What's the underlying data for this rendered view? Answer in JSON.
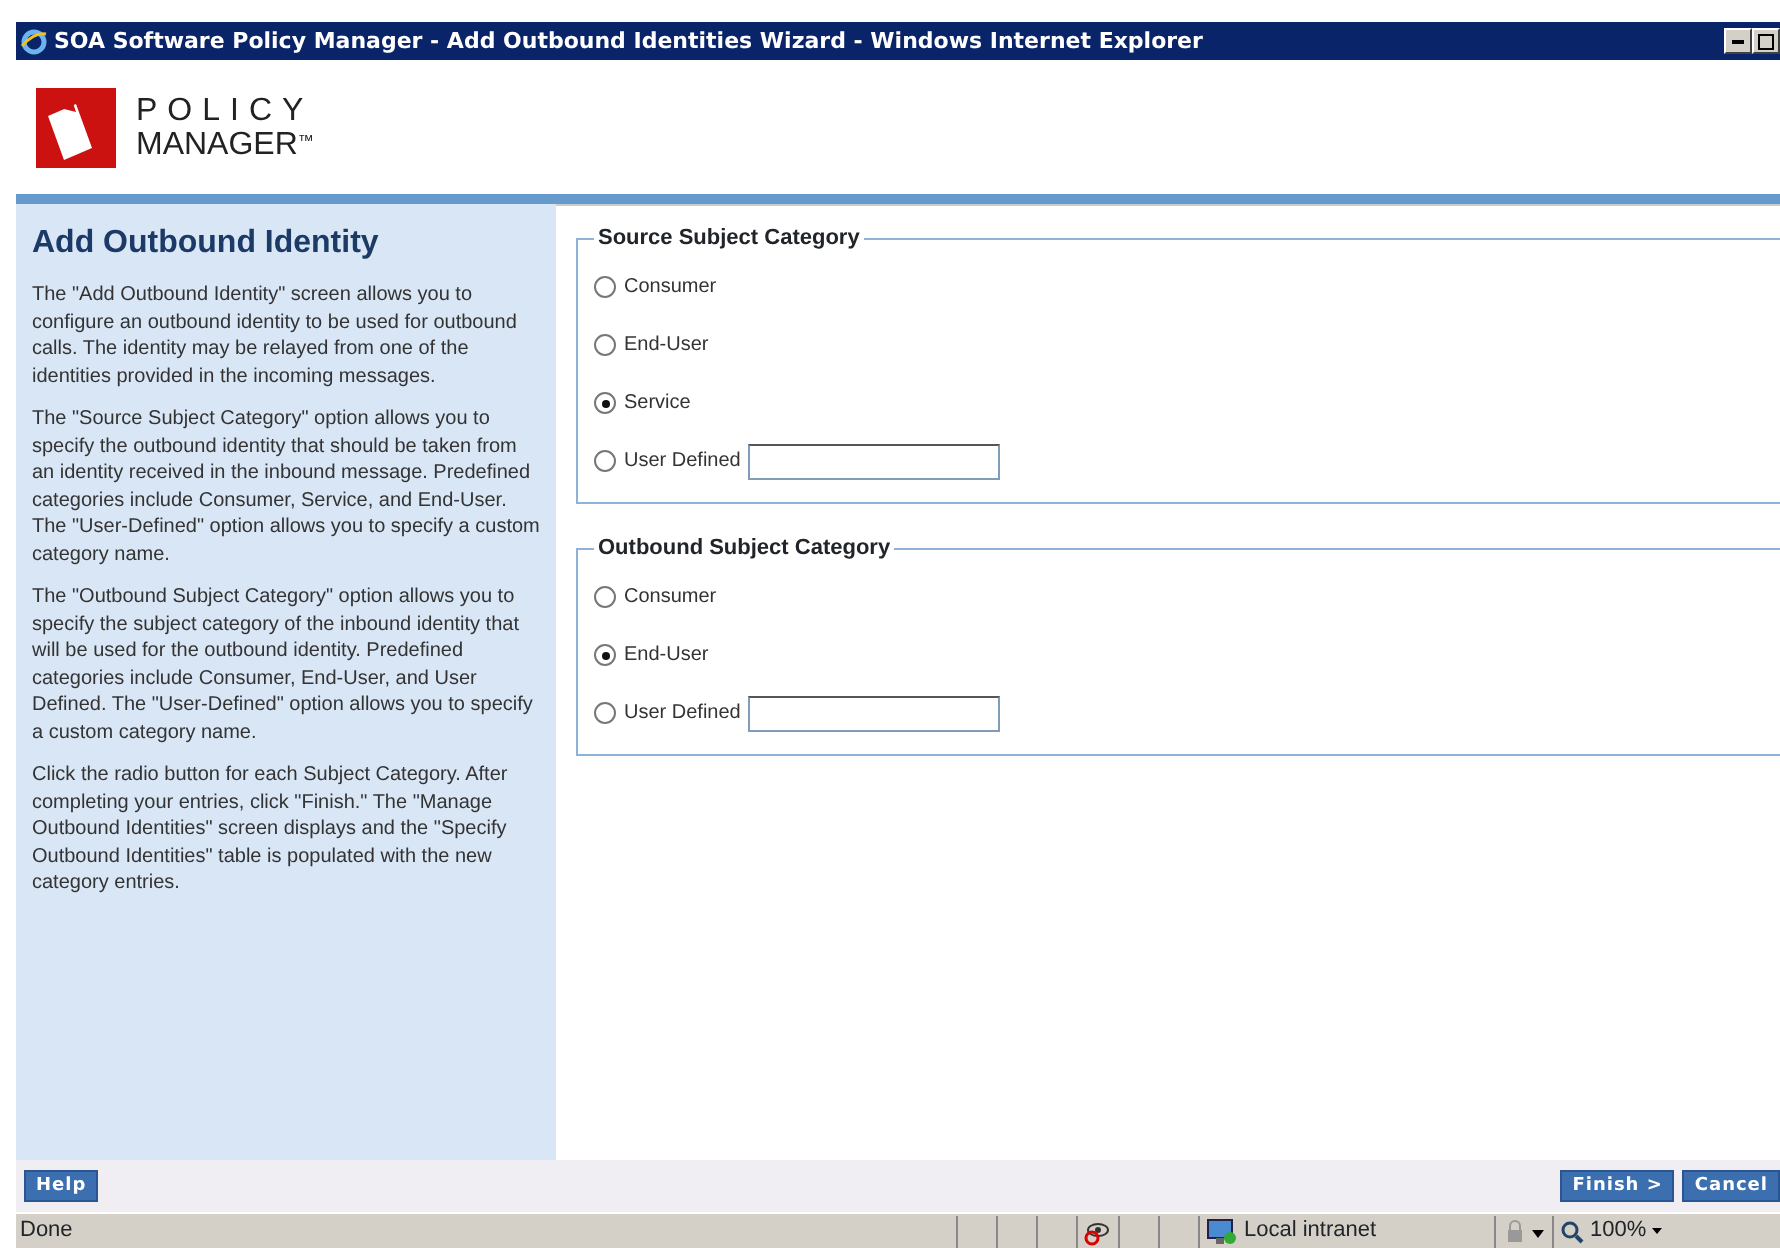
{
  "window": {
    "title": "SOA Software Policy Manager - Add Outbound Identities Wizard - Windows Internet Explorer"
  },
  "logo": {
    "line_1": "POLICY",
    "line_2": "MANAGER",
    "mark": "™"
  },
  "help_panel": {
    "title": "Add Outbound Identity",
    "paragraphs": [
      "The \"Add Outbound Identity\" screen allows you to configure an outbound identity to be used for outbound calls. The identity may be relayed from one of the identities provided in the incoming messages.",
      "The \"Source Subject Category\" option allows you to specify the outbound identity that should be taken from an identity received in the inbound message. Predefined categories include Consumer, Service, and End-User. The \"User-Defined\" option allows you to specify a custom category name.",
      "The \"Outbound Subject Category\" option allows you to specify the subject category of the inbound identity that will be used for the outbound identity. Predefined categories include Consumer, End-User, and User Defined. The \"User-Defined\" option allows you to specify a custom category name.",
      "Click the radio button for each Subject Category. After completing your entries, click \"Finish.\" The \"Manage Outbound Identities\" screen displays and the \"Specify Outbound Identities\" table is populated with the new category entries."
    ]
  },
  "groups": [
    {
      "legend": "Source Subject Category",
      "options": [
        {
          "label": "Consumer",
          "selected": false,
          "kind": "plain"
        },
        {
          "label": "End-User",
          "selected": false,
          "kind": "plain"
        },
        {
          "label": "Service",
          "selected": true,
          "kind": "plain"
        },
        {
          "label": "User Defined",
          "selected": false,
          "kind": "field"
        }
      ]
    },
    {
      "legend": "Outbound Subject Category",
      "options": [
        {
          "label": "Consumer",
          "selected": false,
          "kind": "plain"
        },
        {
          "label": "End-User",
          "selected": true,
          "kind": "plain"
        },
        {
          "label": "User Defined",
          "selected": false,
          "kind": "field"
        }
      ]
    }
  ],
  "buttons": {
    "left": [
      "Help"
    ],
    "right": [
      "Finish >",
      "Cancel"
    ]
  },
  "status_bar": {
    "text": "Done",
    "zone": "Local intranet",
    "zoom": "100%"
  }
}
